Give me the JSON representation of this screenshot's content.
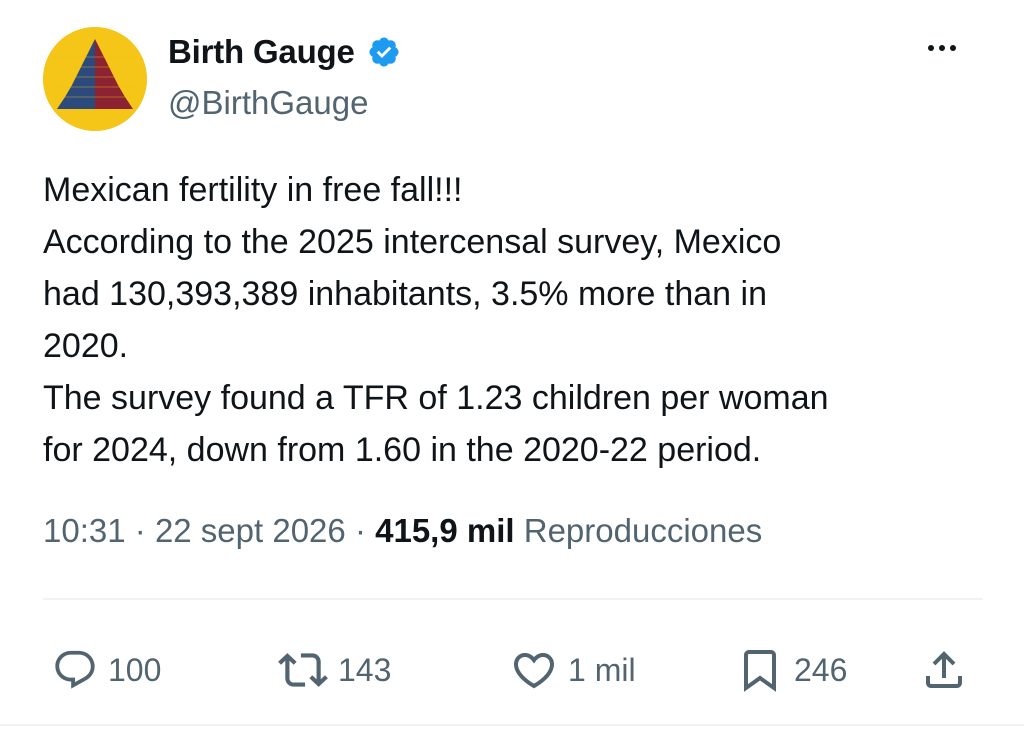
{
  "author": {
    "display_name": "Birth Gauge",
    "handle": "@BirthGauge",
    "verified_icon": "verified-badge-icon",
    "avatar_icon": "population-pyramid-icon"
  },
  "tweet": {
    "lines": [
      "Mexican fertility in free fall!!!",
      "According to the 2025 intercensal survey, Mexico",
      "had 130,393,389 inhabitants, 3.5% more than in",
      "2020.",
      "The survey found a TFR of 1.23 children per woman",
      "for 2024, down from 1.60 in the 2020-22 period."
    ]
  },
  "meta": {
    "time": "10:31",
    "separator": "·",
    "date": "22 sept 2026",
    "views_count": "415,9 mil",
    "views_label": "Reproducciones"
  },
  "actions": {
    "reply": {
      "icon": "reply-icon",
      "count": "100"
    },
    "retweet": {
      "icon": "retweet-icon",
      "count": "143"
    },
    "like": {
      "icon": "heart-icon",
      "count": "1 mil"
    },
    "bookmark": {
      "icon": "bookmark-icon",
      "count": "246"
    },
    "share": {
      "icon": "share-icon"
    }
  },
  "colors": {
    "text_primary": "#0f1419",
    "text_secondary": "#536471",
    "verified_blue": "#1d9bf0",
    "avatar_bg": "#f5c518",
    "pyramid_left": "#2c4a7c",
    "pyramid_right": "#8b2332",
    "divider": "#eff3f4"
  }
}
